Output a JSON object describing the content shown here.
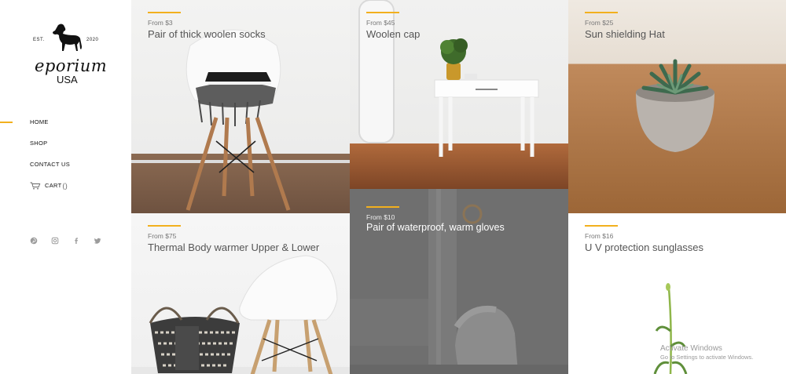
{
  "brand": {
    "est": "EST.",
    "year": "2020",
    "name": "eporium",
    "country": "USA"
  },
  "nav": {
    "home": "HOME",
    "shop": "SHOP",
    "contact": "CONTACT US",
    "cart": "CART",
    "cart_count": "()"
  },
  "social": [
    "pinterest-icon",
    "instagram-icon",
    "facebook-icon",
    "twitter-icon"
  ],
  "accent_color": "#f2b01e",
  "products": [
    {
      "from": "From $3",
      "title": "Pair of thick woolen socks"
    },
    {
      "from": "From $45",
      "title": "Woolen cap"
    },
    {
      "from": "From $25",
      "title": "Sun shielding Hat"
    },
    {
      "from": "From $75",
      "title": "Thermal Body warmer Upper & Lower"
    },
    {
      "from": "From $10",
      "title": "Pair of waterproof, warm gloves"
    },
    {
      "from": "From $16",
      "title": "U V protection sunglasses"
    }
  ],
  "watermark": {
    "line1": "Activate Windows",
    "line2": "Go to Settings to activate Windows."
  }
}
